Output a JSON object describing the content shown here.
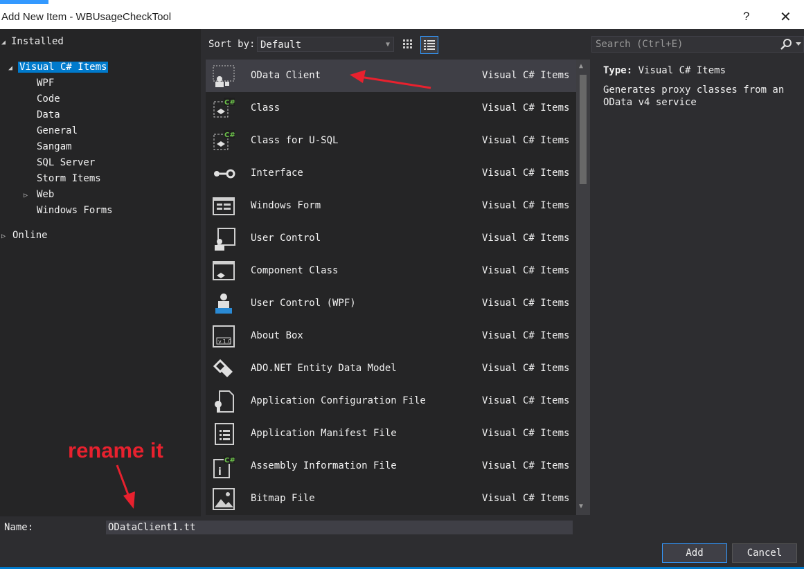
{
  "window": {
    "title": "Add New Item - WBUsageCheckTool",
    "help": "?",
    "close": "✕"
  },
  "tree": {
    "installed": "Installed",
    "selected": "Visual C# Items",
    "children": [
      "WPF",
      "Code",
      "Data",
      "General",
      "Sangam",
      "SQL Server",
      "Storm Items",
      "Web",
      "Windows Forms"
    ],
    "online": "Online"
  },
  "toolbar": {
    "sort_label": "Sort by:",
    "sort_value": "Default"
  },
  "search": {
    "placeholder": "Search (Ctrl+E)"
  },
  "items": [
    {
      "name": "OData Client",
      "category": "Visual C# Items",
      "icon": "odata-client-icon"
    },
    {
      "name": "Class",
      "category": "Visual C# Items",
      "icon": "class-icon"
    },
    {
      "name": "Class for U-SQL",
      "category": "Visual C# Items",
      "icon": "class-usql-icon"
    },
    {
      "name": "Interface",
      "category": "Visual C# Items",
      "icon": "interface-icon"
    },
    {
      "name": "Windows Form",
      "category": "Visual C# Items",
      "icon": "windows-form-icon"
    },
    {
      "name": "User Control",
      "category": "Visual C# Items",
      "icon": "user-control-icon"
    },
    {
      "name": "Component Class",
      "category": "Visual C# Items",
      "icon": "component-class-icon"
    },
    {
      "name": "User Control (WPF)",
      "category": "Visual C# Items",
      "icon": "user-control-wpf-icon"
    },
    {
      "name": "About Box",
      "category": "Visual C# Items",
      "icon": "about-box-icon"
    },
    {
      "name": "ADO.NET Entity Data Model",
      "category": "Visual C# Items",
      "icon": "ado-net-icon"
    },
    {
      "name": "Application Configuration File",
      "category": "Visual C# Items",
      "icon": "app-config-icon"
    },
    {
      "name": "Application Manifest File",
      "category": "Visual C# Items",
      "icon": "app-manifest-icon"
    },
    {
      "name": "Assembly Information File",
      "category": "Visual C# Items",
      "icon": "assembly-info-icon"
    },
    {
      "name": "Bitmap File",
      "category": "Visual C# Items",
      "icon": "bitmap-file-icon"
    }
  ],
  "description": {
    "type_label": "Type:",
    "type_value": "Visual C# Items",
    "text": "Generates proxy classes from an OData v4 service"
  },
  "name_field": {
    "label": "Name:",
    "value": "ODataClient1.tt"
  },
  "buttons": {
    "add": "Add",
    "cancel": "Cancel"
  },
  "annotation": {
    "text": "rename it"
  },
  "colors": {
    "accent": "#007acc",
    "annotation": "#e8212e",
    "background": "#2d2d30"
  }
}
